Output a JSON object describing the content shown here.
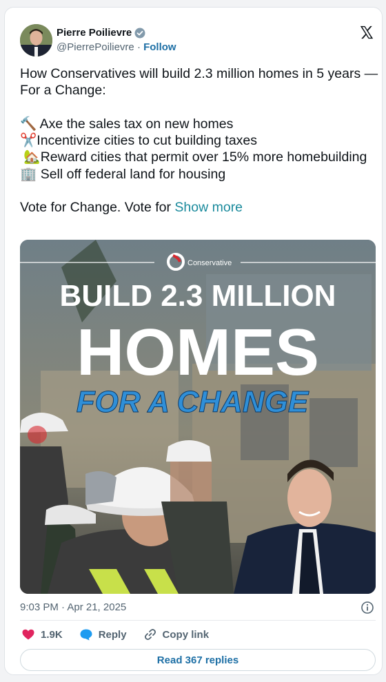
{
  "author": {
    "name": "Pierre Poilievre",
    "handle": "@PierrePoilievre",
    "separator": "·",
    "follow_label": "Follow"
  },
  "tweet": {
    "lines": [
      "How Conservatives will build 2.3 million homes in 5 years — For a Change:",
      "",
      "🔨 Axe the sales tax on new homes",
      "✂️Incentivize cities to cut building taxes",
      " 🏡Reward cities that permit over 15% more homebuilding",
      "🏢 Sell off federal land for housing",
      "",
      "Vote for Change. Vote for "
    ],
    "show_more_label": "Show more"
  },
  "media": {
    "brand": "Conservative",
    "headline_1": "BUILD 2.3 MILLION",
    "headline_2": "HOMES",
    "headline_3": "FOR A CHANGE"
  },
  "meta": {
    "timestamp": "9:03 PM · Apr 21, 2025"
  },
  "actions": {
    "likes": "1.9K",
    "reply_label": "Reply",
    "copy_link_label": "Copy link",
    "read_replies_label": "Read 367 replies"
  },
  "colors": {
    "like": "#e0245e",
    "reply": "#1d9bf0",
    "link_blue": "#1d6fa5",
    "show_more": "#1a8a9c",
    "headline_blue": "#2f8fd8",
    "brand_red": "#d7282f"
  }
}
